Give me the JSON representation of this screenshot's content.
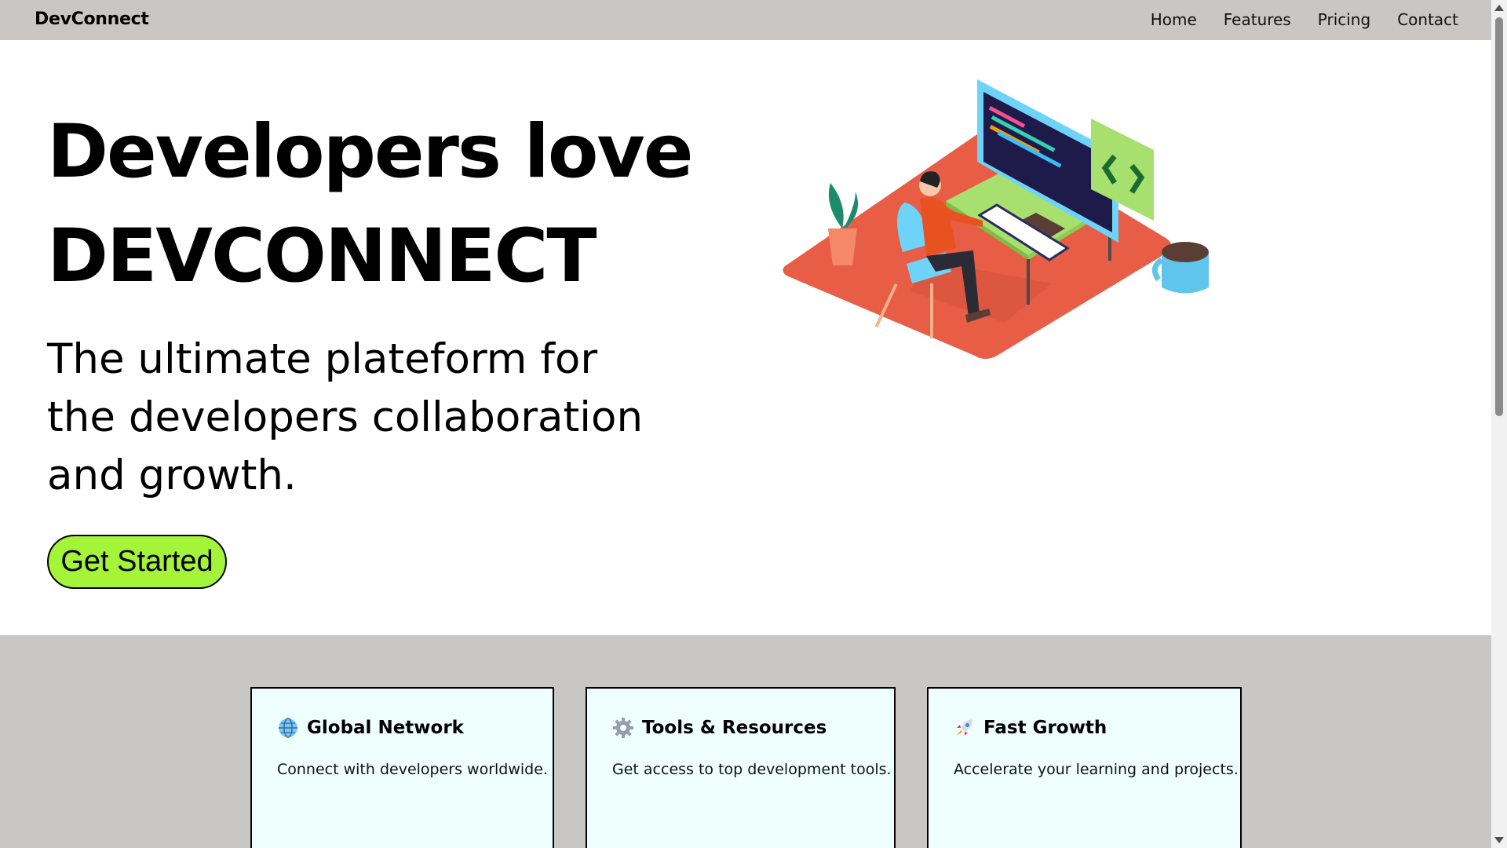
{
  "navbar": {
    "brand": "DevConnect",
    "links": [
      "Home",
      "Features",
      "Pricing",
      "Contact"
    ]
  },
  "hero": {
    "title_line1": "Developers love",
    "title_line2": "DEVCONNECT",
    "subtitle": "The ultimate plateform for the developers collaboration and growth.",
    "cta_label": "Get Started",
    "illustration": "developer-at-desk-illustration"
  },
  "features": [
    {
      "icon": "globe-icon",
      "title": "Global Network",
      "description": "Connect with developers worldwide."
    },
    {
      "icon": "gear-icon",
      "title": "Tools & Resources",
      "description": "Get access to top development tools."
    },
    {
      "icon": "rocket-icon",
      "title": "Fast Growth",
      "description": "Accelerate your learning and projects."
    }
  ],
  "colors": {
    "navbar_bg": "#c8c7c6",
    "cta_bg": "#a4f43a",
    "card_bg": "#effffe",
    "floor": "#e85d45"
  }
}
